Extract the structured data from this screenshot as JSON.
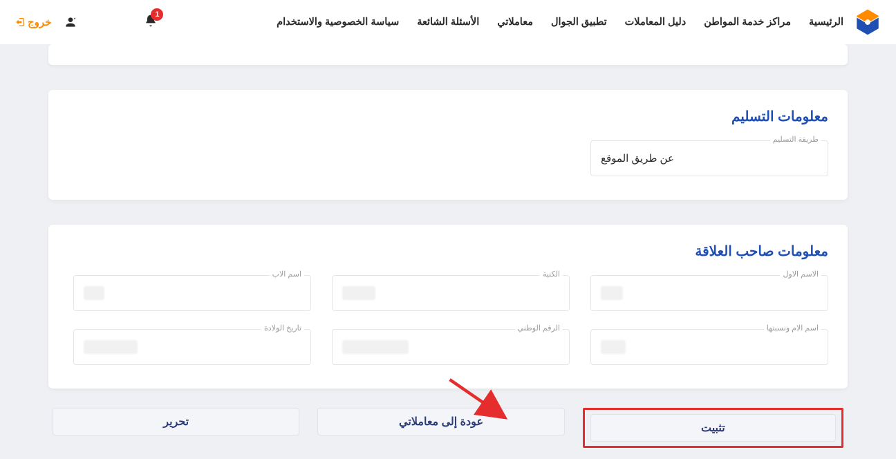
{
  "header": {
    "nav": {
      "home": "الرئيسية",
      "centers": "مراكز خدمة المواطن",
      "guide": "دليل المعاملات",
      "app": "تطبيق الجوال",
      "mytrans": "معاملاتي",
      "faq": "الأسئلة الشائعة",
      "privacy": "سياسة الخصوصية والاستخدام"
    },
    "badge_count": "1",
    "username": " ",
    "logout": "خروج"
  },
  "delivery": {
    "title": "معلومات التسليم",
    "method_label": "طريقة التسليم",
    "method_value": "عن طريق الموقع"
  },
  "owner": {
    "title": "معلومات صاحب العلاقة",
    "first_name_label": "الاسم الاول",
    "surname_label": "الكنية",
    "father_label": "اسم الاب",
    "mother_label": "اسم الام ونسبتها",
    "national_id_label": "الرقم الوطني",
    "dob_label": "تاريخ الولادة"
  },
  "buttons": {
    "confirm": "تثبيت",
    "back": "عودة إلى معاملاتي",
    "edit": "تحرير"
  }
}
